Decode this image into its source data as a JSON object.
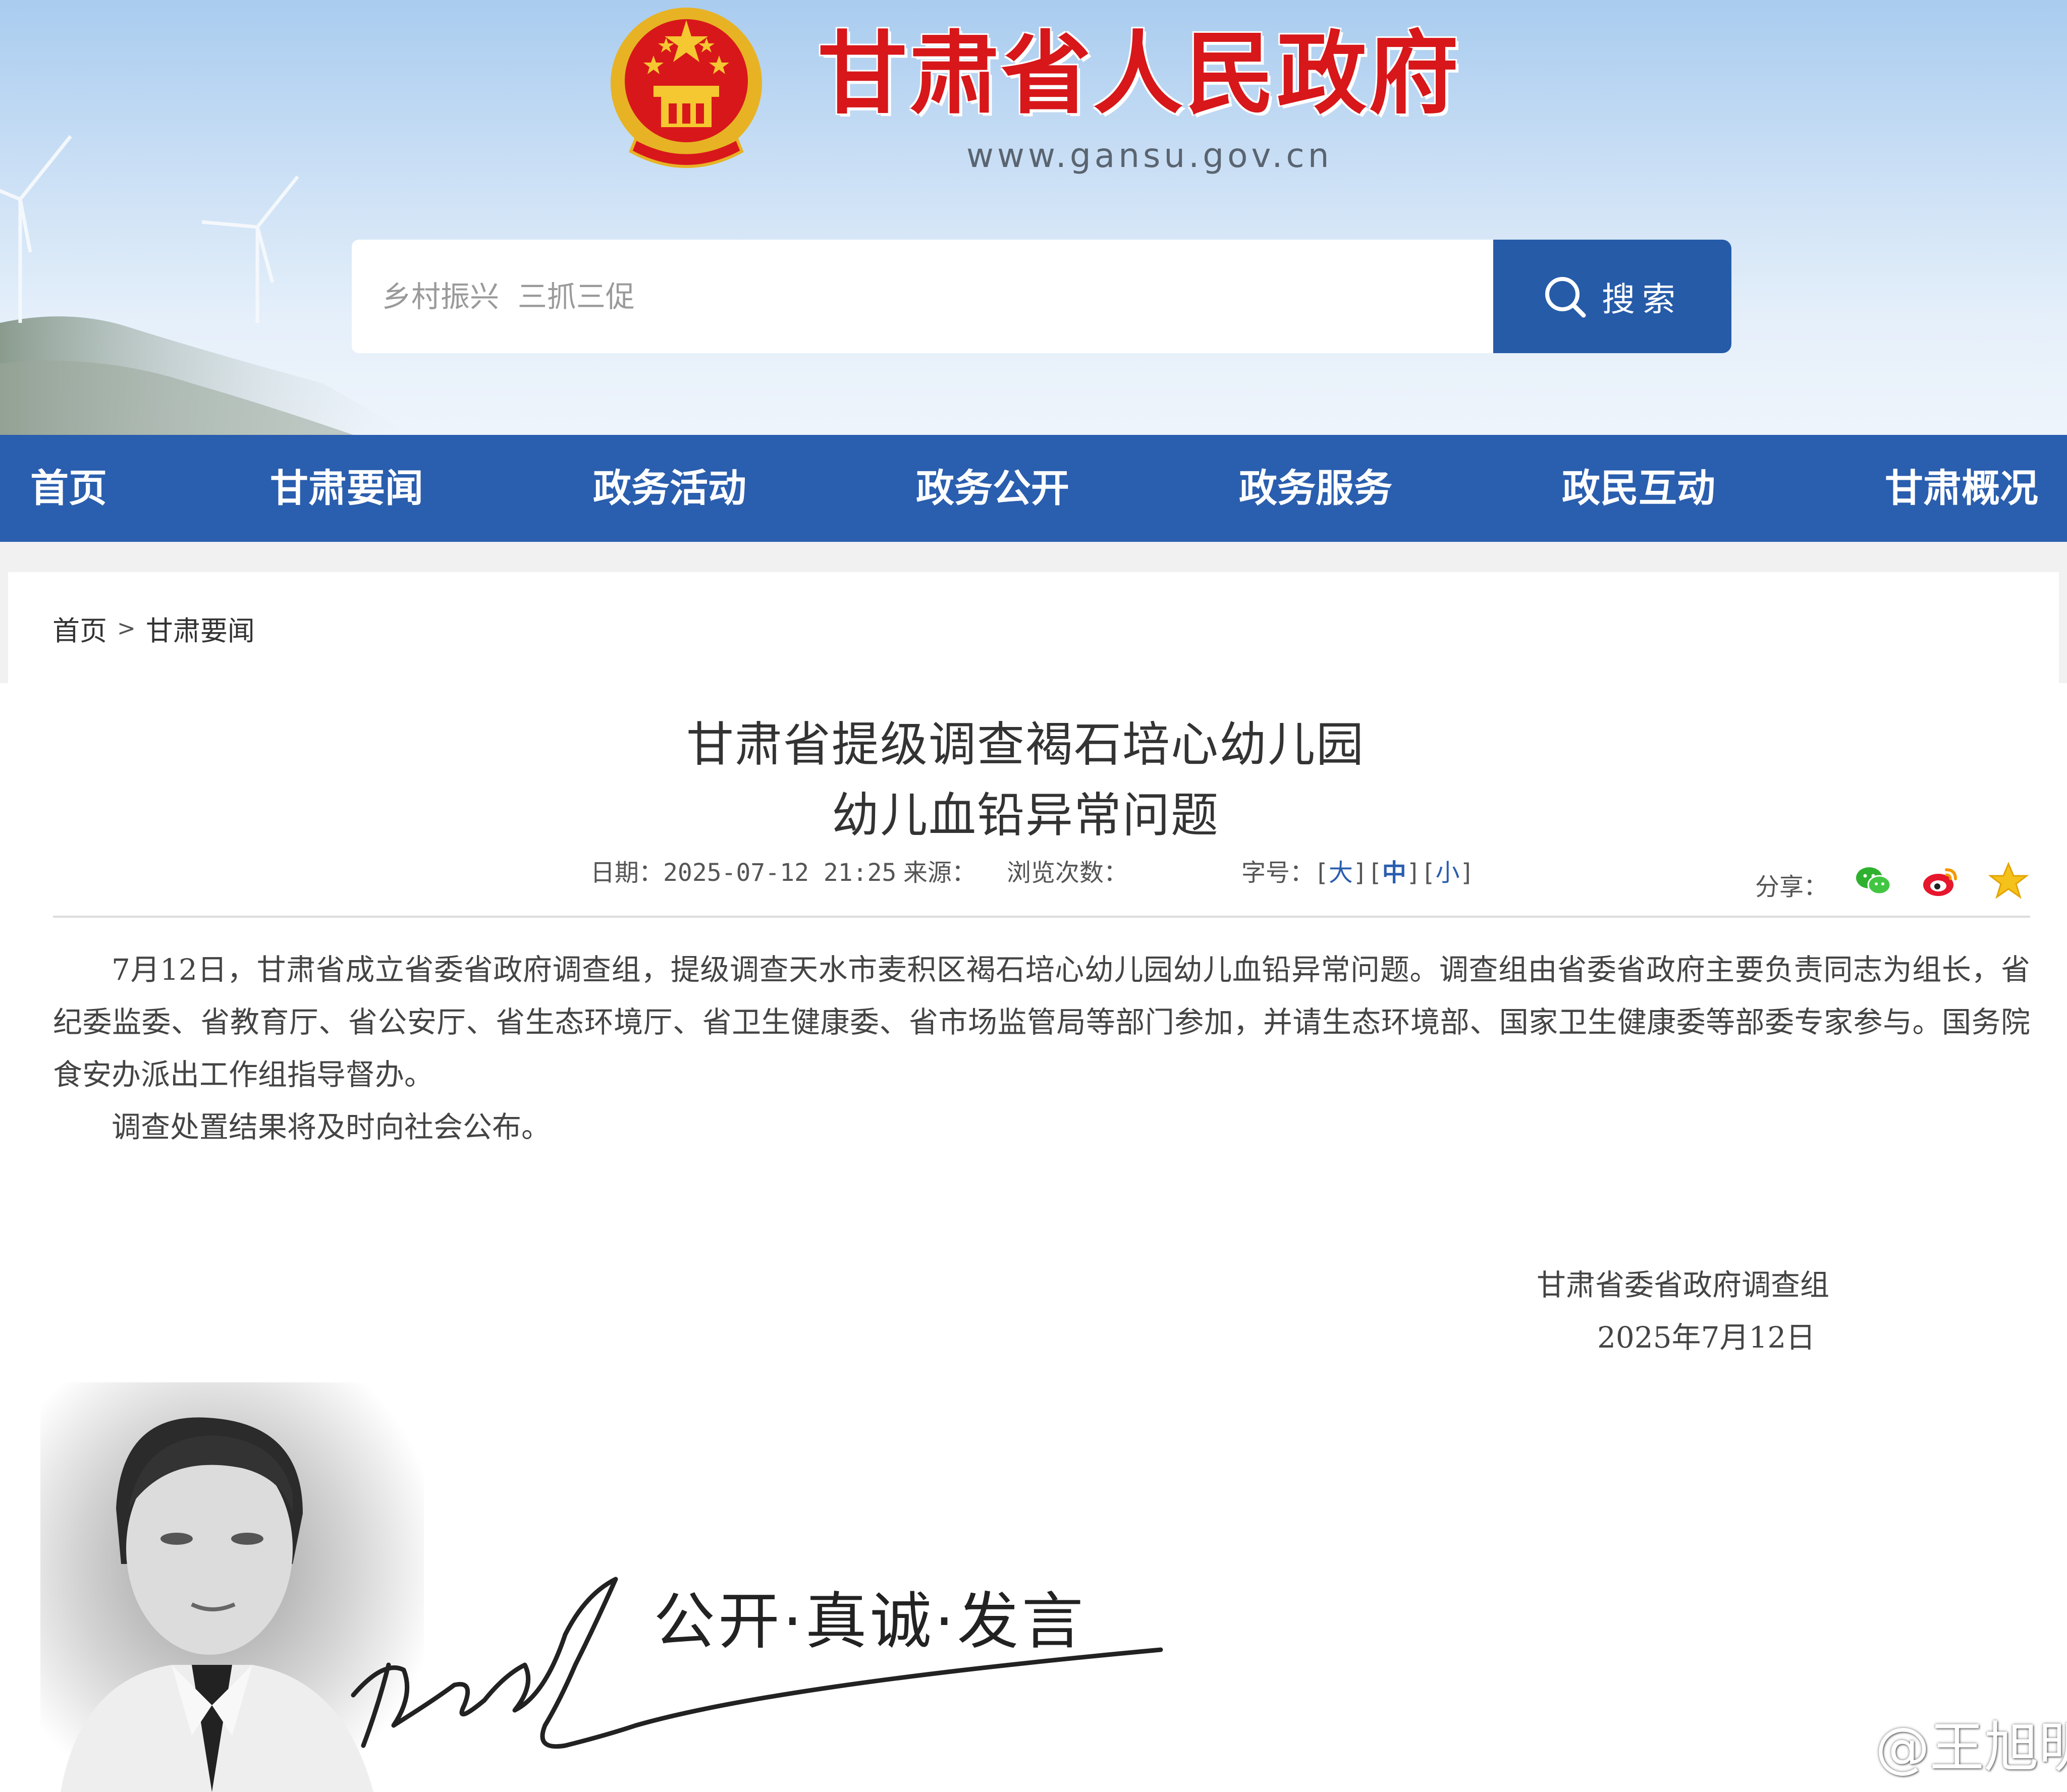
{
  "header": {
    "site_title": "甘肃省人民政府",
    "site_url": "www.gansu.gov.cn",
    "search": {
      "placeholder": "乡村振兴  三抓三促",
      "button_label": "搜索"
    }
  },
  "nav": {
    "items": [
      {
        "label": "首页"
      },
      {
        "label": "甘肃要闻"
      },
      {
        "label": "政务活动"
      },
      {
        "label": "政务公开"
      },
      {
        "label": "政务服务"
      },
      {
        "label": "政民互动"
      },
      {
        "label": "甘肃概况"
      }
    ]
  },
  "breadcrumb": {
    "home": "首页",
    "separator": ">",
    "current": "甘肃要闻"
  },
  "article": {
    "title_line1": "甘肃省提级调查褐石培心幼儿园",
    "title_line2": "幼儿血铅异常问题",
    "meta": {
      "date_label": "日期：",
      "date": "2025-07-12 21:25",
      "source_label": "来源：",
      "views_label": "浏览次数：",
      "font_size_label": "字号：",
      "size_large": "大",
      "size_medium": "中",
      "size_small": "小",
      "share_label": "分享："
    },
    "paragraphs": [
      "7月12日，甘肃省成立省委省政府调查组，提级调查天水市麦积区褐石培心幼儿园幼儿血铅异常问题。调查组由省委省政府主要负责同志为组长，省纪委监委、省教育厅、省公安厅、省生态环境厅、省卫生健康委、省市场监管局等部门参加，并请生态环境部、国家卫生健康委等部委专家参与。国务院食安办派出工作组指导督办。",
      "调查处置结果将及时向社会公布。"
    ],
    "signer": "甘肃省委省政府调查组",
    "signed_date": "2025年7月12日"
  },
  "banner": {
    "slogan": "公开·真诚·发言",
    "watermark": "@王旭明"
  },
  "colors": {
    "nav_bg": "#2a5eae",
    "search_button_bg": "#265ba8",
    "title_red": "#d7171a"
  }
}
